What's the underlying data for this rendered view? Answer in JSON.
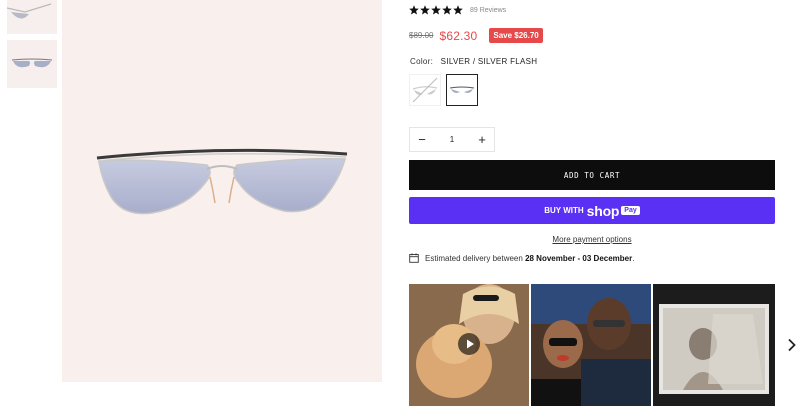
{
  "product": {
    "reviews_label": "89 Reviews",
    "rating": 5,
    "old_price": "$89.00",
    "new_price": "$62.30",
    "save_badge": "Save $26.70",
    "color_label": "Color:",
    "color_value": "SILVER / SILVER FLASH",
    "quantity": "1",
    "minus_symbol": "−",
    "plus_symbol": "+",
    "add_to_cart_label": "ADD TO CART",
    "shop_pay": {
      "buy_with": "BUY WITH",
      "shop": "shop",
      "pay": "Pay"
    },
    "more_payment_options": "More payment options",
    "delivery": {
      "prefix": "Estimated delivery between",
      "dates": "28 November - 03 December",
      "suffix": "."
    }
  },
  "icons": {
    "star": "star-icon",
    "calendar": "calendar-icon",
    "play": "play-icon",
    "chevron_right": "chevron-right-icon"
  },
  "colors": {
    "accent_red": "#e5494a",
    "shop_pay_purple": "#5a31f4",
    "cart_black": "#0d0d0d",
    "image_bg": "#f9efed"
  }
}
